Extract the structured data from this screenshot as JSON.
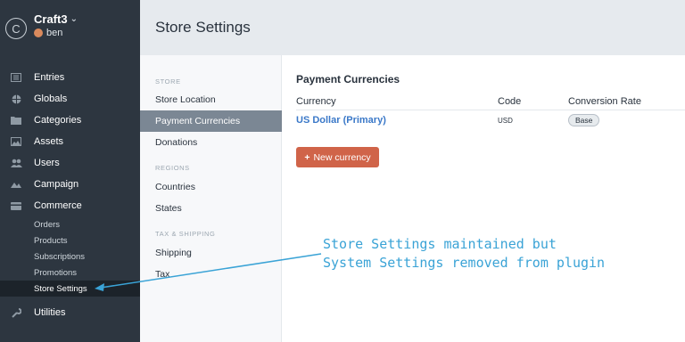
{
  "sidebar": {
    "site_name": "Craft3",
    "site_logo_letter": "C",
    "user_name": "ben",
    "nav": [
      {
        "label": "Entries",
        "icon": "entries-icon"
      },
      {
        "label": "Globals",
        "icon": "globe-icon"
      },
      {
        "label": "Categories",
        "icon": "folder-icon"
      },
      {
        "label": "Assets",
        "icon": "image-icon"
      },
      {
        "label": "Users",
        "icon": "users-icon"
      },
      {
        "label": "Campaign",
        "icon": "campaign-icon"
      },
      {
        "label": "Commerce",
        "icon": "commerce-icon"
      }
    ],
    "commerce_sub": [
      "Orders",
      "Products",
      "Subscriptions",
      "Promotions",
      "Store Settings"
    ],
    "utilities": {
      "label": "Utilities",
      "icon": "wrench-icon"
    }
  },
  "header": {
    "title": "Store Settings"
  },
  "settings_nav": {
    "store_heading": "STORE",
    "store_items": [
      "Store Location",
      "Payment Currencies",
      "Donations"
    ],
    "regions_heading": "REGIONS",
    "regions_items": [
      "Countries",
      "States"
    ],
    "tax_heading": "TAX & SHIPPING",
    "tax_items": [
      "Shipping",
      "Tax"
    ],
    "active": "Payment Currencies"
  },
  "main": {
    "title": "Payment Currencies",
    "columns": [
      "Currency",
      "Code",
      "Conversion Rate"
    ],
    "rows": [
      {
        "currency": "US Dollar (Primary)",
        "code": "USD",
        "rate": "Base"
      }
    ],
    "new_button": "New currency"
  },
  "annotation": {
    "line1": "Store Settings maintained but",
    "line2": "System Settings removed from plugin"
  },
  "colors": {
    "sidebar": "#2d3640",
    "accent_button": "#d06449",
    "link": "#3a78c8",
    "annotation": "#3aa3d6"
  }
}
